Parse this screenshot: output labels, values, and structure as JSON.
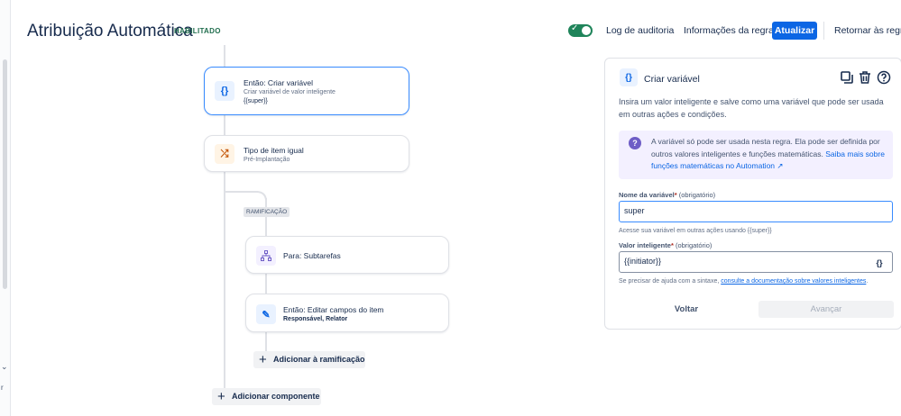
{
  "header": {
    "title": "Atribuição Automática",
    "status_badge": "HABILITADO",
    "toggle_on": true,
    "audit_log": "Log de auditoria",
    "rule_info": "Informações da regra",
    "update": "Atualizar",
    "back_to_rules": "Retornar às regras",
    "colors": {
      "accent": "#0c66e4",
      "toggle": "#1f845a",
      "badge": "#216e4e"
    }
  },
  "flow": {
    "create_variable": {
      "title": "Então: Criar variável",
      "subtitle": "Criar variável de valor inteligente",
      "detail": "{{super}}",
      "icon": "curly-braces-icon"
    },
    "issue_type": {
      "title": "Tipo de item igual",
      "subtitle": "Pré-Implantação",
      "icon": "shuffle-icon"
    },
    "branch_tag": "RAMIFICAÇÃO",
    "subtasks": {
      "title": "Para: Subtarefas",
      "icon": "hierarchy-icon"
    },
    "edit_fields": {
      "title": "Então: Editar campos do item",
      "subtitle": "Responsável, Relator",
      "icon": "pencil-icon"
    },
    "add_to_branch": "Adicionar à ramificação",
    "add_component": "Adicionar componente"
  },
  "panel": {
    "title": "Criar variável",
    "description": "Insira um valor inteligente e salve como uma variável que pode ser usada em outras ações e condições.",
    "info_text": "A variável só pode ser usada nesta regra. Ela pode ser definida por outros valores inteligentes e funções matemáticas.",
    "info_link": "Saiba mais sobre funções matemáticas no Automation ↗",
    "name_label": "Nome da variável",
    "name_required_mark": "*",
    "name_optional": "(obrigatório)",
    "name_value": "super",
    "name_help": "Acesse sua variável em outras ações usando {{super}}",
    "smart_label": "Valor inteligente",
    "smart_required_mark": "*",
    "smart_optional": "(obrigatório)",
    "smart_value": "{{initiator}}",
    "smart_button": "{}",
    "smart_help_prefix": "Se precisar de ajuda com a sintaxe,",
    "smart_help_link": "consulte a documentação sobre valores inteligentes",
    "smart_help_suffix": ".",
    "back": "Voltar",
    "next": "Avançar"
  }
}
